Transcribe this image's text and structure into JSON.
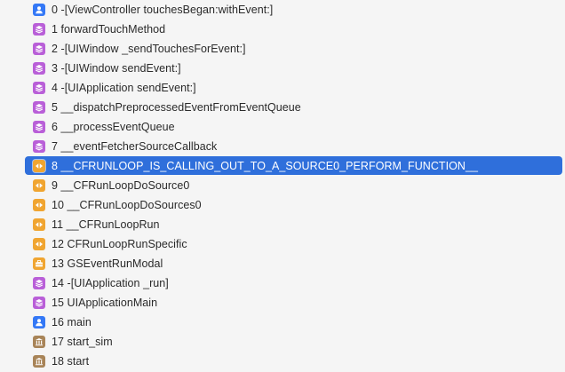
{
  "colors": {
    "user": "#3478f6",
    "objc": "#b95fd8",
    "system": "#f0a531",
    "lib": "#a88458",
    "selected_row": "#2f6fdb"
  },
  "frames": [
    {
      "label": "0 -[ViewController touchesBegan:withEvent:]",
      "kind": "user",
      "icon": "person-icon"
    },
    {
      "label": "1 forwardTouchMethod",
      "kind": "objc",
      "icon": "stack-icon"
    },
    {
      "label": "2 -[UIWindow _sendTouchesForEvent:]",
      "kind": "objc",
      "icon": "stack-icon"
    },
    {
      "label": "3 -[UIWindow sendEvent:]",
      "kind": "objc",
      "icon": "stack-icon"
    },
    {
      "label": "4 -[UIApplication sendEvent:]",
      "kind": "objc",
      "icon": "stack-icon"
    },
    {
      "label": "5 __dispatchPreprocessedEventFromEventQueue",
      "kind": "objc",
      "icon": "stack-icon"
    },
    {
      "label": "6 __processEventQueue",
      "kind": "objc",
      "icon": "stack-icon"
    },
    {
      "label": "7 __eventFetcherSourceCallback",
      "kind": "objc",
      "icon": "stack-icon"
    },
    {
      "label": "8 __CFRUNLOOP_IS_CALLING_OUT_TO_A_SOURCE0_PERFORM_FUNCTION__",
      "kind": "system",
      "icon": "runloop-icon",
      "selected": true
    },
    {
      "label": "9 __CFRunLoopDoSource0",
      "kind": "system",
      "icon": "runloop-icon"
    },
    {
      "label": "10 __CFRunLoopDoSources0",
      "kind": "system",
      "icon": "runloop-icon"
    },
    {
      "label": "11 __CFRunLoopRun",
      "kind": "system",
      "icon": "runloop-icon"
    },
    {
      "label": "12 CFRunLoopRunSpecific",
      "kind": "system",
      "icon": "runloop-icon"
    },
    {
      "label": "13 GSEventRunModal",
      "kind": "system",
      "icon": "toolbox-icon"
    },
    {
      "label": "14 -[UIApplication _run]",
      "kind": "objc",
      "icon": "stack-icon"
    },
    {
      "label": "15 UIApplicationMain",
      "kind": "objc",
      "icon": "stack-icon"
    },
    {
      "label": "16 main",
      "kind": "user",
      "icon": "person-icon"
    },
    {
      "label": "17 start_sim",
      "kind": "lib",
      "icon": "library-icon"
    },
    {
      "label": "18 start",
      "kind": "lib",
      "icon": "library-icon"
    }
  ]
}
